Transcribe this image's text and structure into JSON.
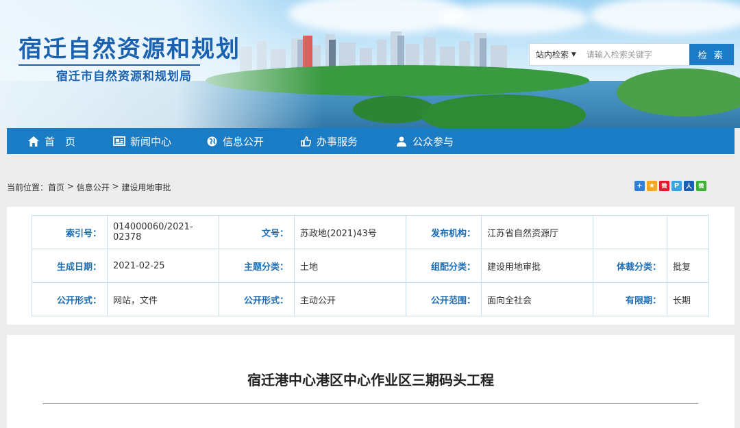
{
  "header": {
    "site_title": "宿迁自然资源和规划",
    "site_subtitle": "宿迁市自然资源和规划局",
    "search": {
      "scope": "站内检索",
      "placeholder": "请输入检索关键字",
      "button": "检 索"
    }
  },
  "nav": {
    "items": [
      {
        "label": "首　页",
        "icon": "home-icon"
      },
      {
        "label": "新闻中心",
        "icon": "newspaper-icon"
      },
      {
        "label": "信息公开",
        "icon": "globe-icon"
      },
      {
        "label": "办事服务",
        "icon": "thumbs-up-icon"
      },
      {
        "label": "公众参与",
        "icon": "user-icon"
      }
    ]
  },
  "breadcrumb": {
    "prefix": "当前位置：",
    "items": [
      "首页",
      "信息公开",
      "建设用地审批"
    ],
    "sep": " > "
  },
  "share": {
    "icons": [
      {
        "name": "share-plus-icon",
        "glyph": "+",
        "color": "#2f7ed8"
      },
      {
        "name": "qzone-icon",
        "glyph": "★",
        "color": "#f5a623"
      },
      {
        "name": "weibo-icon",
        "glyph": "微",
        "color": "#e6162d"
      },
      {
        "name": "tencent-weibo-icon",
        "glyph": "P",
        "color": "#3aa3e3"
      },
      {
        "name": "renren-icon",
        "glyph": "人",
        "color": "#1a5fb4"
      },
      {
        "name": "wechat-icon",
        "glyph": "微",
        "color": "#3cb034"
      }
    ]
  },
  "meta": {
    "rows": [
      [
        {
          "key": "索引号：",
          "value": "014000060/2021-02378"
        },
        {
          "key": "文号：",
          "value": "苏政地(2021)43号"
        },
        {
          "key": "发布机构：",
          "value": "江苏省自然资源厅"
        },
        {
          "key": "",
          "value": ""
        }
      ],
      [
        {
          "key": "生成日期：",
          "value": "2021-02-25"
        },
        {
          "key": "主题分类：",
          "value": "土地"
        },
        {
          "key": "组配分类：",
          "value": "建设用地审批"
        },
        {
          "key": "体裁分类：",
          "value": "批复"
        }
      ],
      [
        {
          "key": "公开形式：",
          "value": "网站，文件"
        },
        {
          "key": "公开形式：",
          "value": "主动公开"
        },
        {
          "key": "公开范围：",
          "value": "面向全社会"
        },
        {
          "key": "有限期：",
          "value": "长期"
        }
      ]
    ]
  },
  "article": {
    "title": "宿迁港中心港区中心作业区三期码头工程"
  },
  "colors": {
    "brand_blue": "#1b7cc6",
    "title_blue": "#1a62b0",
    "key_blue": "#1b6cb5"
  }
}
